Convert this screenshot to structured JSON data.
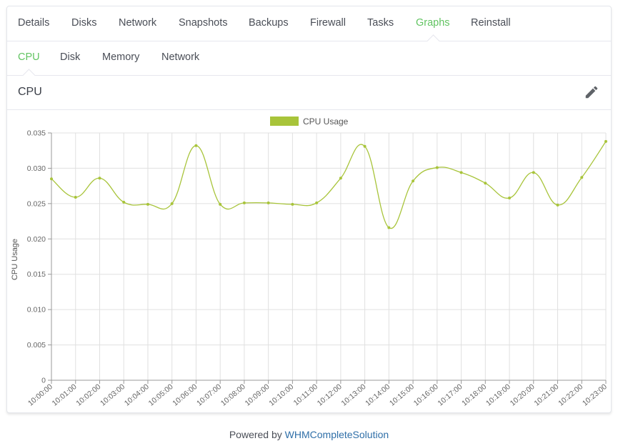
{
  "tabs": [
    {
      "label": "Details",
      "active": false
    },
    {
      "label": "Disks",
      "active": false
    },
    {
      "label": "Network",
      "active": false
    },
    {
      "label": "Snapshots",
      "active": false
    },
    {
      "label": "Backups",
      "active": false
    },
    {
      "label": "Firewall",
      "active": false
    },
    {
      "label": "Tasks",
      "active": false
    },
    {
      "label": "Graphs",
      "active": true
    },
    {
      "label": "Reinstall",
      "active": false
    }
  ],
  "subtabs": [
    {
      "label": "CPU",
      "active": true
    },
    {
      "label": "Disk",
      "active": false
    },
    {
      "label": "Memory",
      "active": false
    },
    {
      "label": "Network",
      "active": false
    }
  ],
  "panel": {
    "title": "CPU",
    "edit_icon": "pencil-icon"
  },
  "colors": {
    "accent": "#62c462",
    "series": "#a8c43a",
    "link": "#2f6fa8"
  },
  "footer": {
    "prefix": "Powered by ",
    "link_text": "WHMCompleteSolution"
  },
  "chart_data": {
    "type": "line",
    "title": "",
    "xlabel": "",
    "ylabel": "CPU Usage",
    "legend": {
      "entries": [
        "CPU Usage"
      ],
      "placement": "top-center"
    },
    "grid": true,
    "ylim": [
      0,
      0.035
    ],
    "yticks": [
      "0",
      "0.005",
      "0.010",
      "0.015",
      "0.020",
      "0.025",
      "0.030",
      "0.035"
    ],
    "x": [
      "10:00:00",
      "10:01:00",
      "10:02:00",
      "10:03:00",
      "10:04:00",
      "10:05:00",
      "10:06:00",
      "10:07:00",
      "10:08:00",
      "10:09:00",
      "10:10:00",
      "10:11:00",
      "10:12:00",
      "10:13:00",
      "10:14:00",
      "10:15:00",
      "10:16:00",
      "10:17:00",
      "10:18:00",
      "10:19:00",
      "10:20:00",
      "10:21:00",
      "10:22:00",
      "10:23:00"
    ],
    "series": [
      {
        "name": "CPU Usage",
        "values": [
          0.0285,
          0.0259,
          0.0286,
          0.0252,
          0.0249,
          0.025,
          0.0332,
          0.0249,
          0.0251,
          0.0251,
          0.0249,
          0.0251,
          0.0286,
          0.0331,
          0.0216,
          0.0282,
          0.0301,
          0.0294,
          0.0279,
          0.0258,
          0.0294,
          0.0248,
          0.0287,
          0.0338
        ]
      }
    ]
  }
}
